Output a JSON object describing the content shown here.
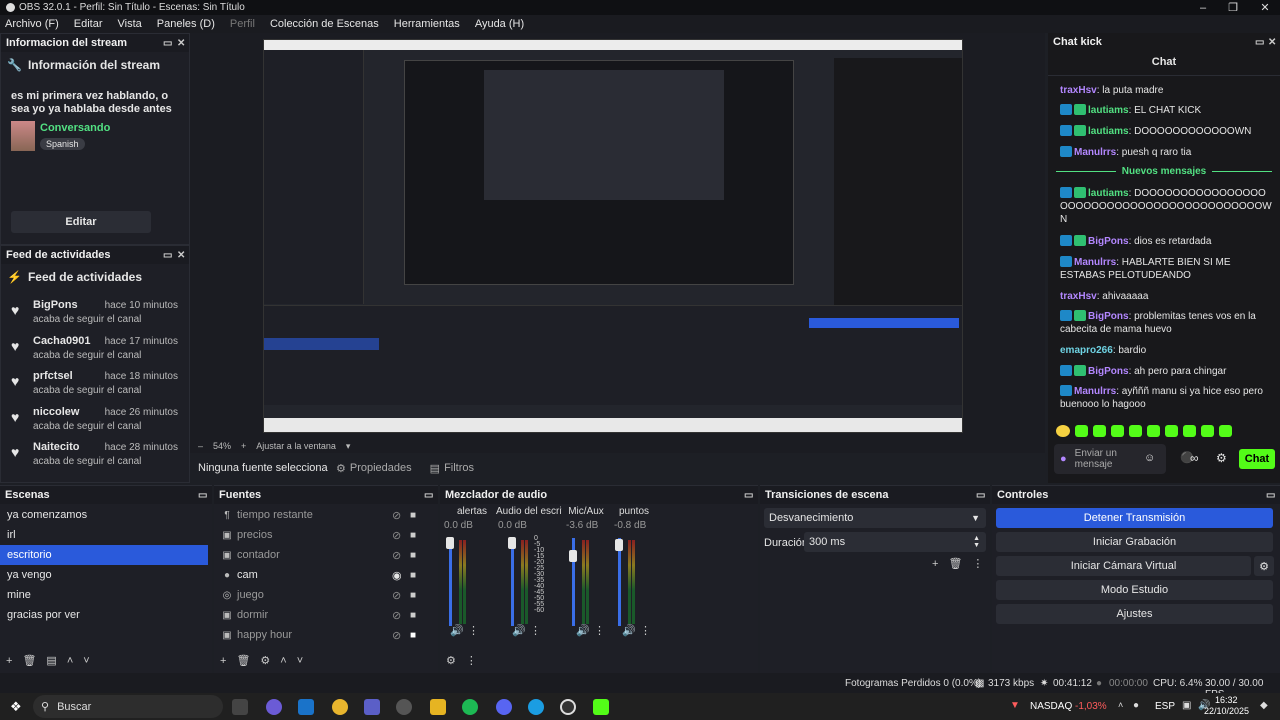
{
  "window": {
    "title": "OBS 32.0.1 - Perfil: Sin Título - Escenas: Sin Título"
  },
  "menu": [
    "Archivo (F)",
    "Editar",
    "Vista",
    "Paneles (D)",
    "Perfil",
    "Colección de Escenas",
    "Herramientas",
    "Ayuda (H)"
  ],
  "stream_info": {
    "dock_title": "Informacion del stream",
    "header": "Información del stream",
    "title": "es mi primera vez hablando, o sea yo ya hablaba desde antes",
    "category": "Conversando",
    "language": "Spanish",
    "edit_label": "Editar"
  },
  "activity": {
    "dock_title": "Feed de actividades",
    "header": "Feed de actividades",
    "items": [
      {
        "name": "BigPons",
        "time": "hace 10 minutos",
        "action": "acaba de seguir el canal"
      },
      {
        "name": "Cacha0901",
        "time": "hace 17 minutos",
        "action": "acaba de seguir el canal"
      },
      {
        "name": "prfctsel",
        "time": "hace 18 minutos",
        "action": "acaba de seguir el canal"
      },
      {
        "name": "niccolew",
        "time": "hace 26 minutos",
        "action": "acaba de seguir el canal"
      },
      {
        "name": "Naitecito",
        "time": "hace 28 minutos",
        "action": "acaba de seguir el canal"
      }
    ]
  },
  "preview_bar": {
    "zoom": "54%",
    "fit_label": "Ajustar a la ventana"
  },
  "source_bar": {
    "status": "Ninguna fuente seleccionad",
    "props_label": "Propiedades",
    "filters_label": "Filtros"
  },
  "chat": {
    "dock_title": "Chat kick",
    "header": "Chat",
    "messages": [
      {
        "user": "traxHsv",
        "text": ": la puta madre"
      },
      {
        "user": "lautiams",
        "text": ": EL CHAT KICK"
      },
      {
        "user": "lautiams",
        "text": ": DOOOOOOOOOOOOWN"
      },
      {
        "user": "Manulrrs",
        "text": ": puesh q raro tia"
      },
      {
        "user": "lautiams",
        "text": ": DOOOOOOOOOOOOOOOOOOOOOOOOOOOOOOOOOOOOOOOOOOWN"
      },
      {
        "user": "BigPons",
        "text": ": dios es retardada"
      },
      {
        "user": "Manulrrs",
        "text": ": HABLARTE BIEN SI ME ESTABAS PELOTUDEANDO"
      },
      {
        "user": "traxHsv",
        "text": ": ahivaaaaa"
      },
      {
        "user": "BigPons",
        "text": ": problemitas tenes vos en la cabecita de mama huevo"
      },
      {
        "user": "emapro266",
        "text": ": bardio"
      },
      {
        "user": "BigPons",
        "text": ": ah pero para chingar"
      },
      {
        "user": "Manulrrs",
        "text": ": ayñññ manu si ya hice eso pero buenooo lo hagooo"
      }
    ],
    "new_messages_label": "Nuevos mensajes",
    "input_placeholder": "Enviar un mensaje",
    "infinity": "∞",
    "send_label": "Chat"
  },
  "scenes": {
    "dock_title": "Escenas",
    "items": [
      "ya comenzamos",
      "irl",
      "escritorio",
      "ya vengo",
      "mine",
      "gracias por ver"
    ],
    "selected": "escritorio"
  },
  "sources": {
    "dock_title": "Fuentes",
    "items": [
      {
        "name": "tiempo restante",
        "icon": "text-icon"
      },
      {
        "name": "precios",
        "icon": "image-icon"
      },
      {
        "name": "contador",
        "icon": "image-icon"
      },
      {
        "name": "cam",
        "icon": "camera-icon"
      },
      {
        "name": "juego",
        "icon": "gamepad-icon"
      },
      {
        "name": "dormir",
        "icon": "image-icon"
      },
      {
        "name": "happy hour",
        "icon": "image-icon"
      }
    ]
  },
  "mixer": {
    "dock_title": "Mezclador de audio",
    "channels": [
      {
        "name": "alertas",
        "db": "0.0 dB"
      },
      {
        "name": "Audio del escritorio",
        "db": "0.0 dB"
      },
      {
        "name": "Mic/Aux",
        "db": "-3.6 dB"
      },
      {
        "name": "puntos",
        "db": "-0.8 dB"
      }
    ],
    "scale": [
      "0",
      "-5",
      "-10",
      "-15",
      "-20",
      "-25",
      "-30",
      "-35",
      "-40",
      "-45",
      "-50",
      "-55",
      "-60"
    ]
  },
  "transitions": {
    "dock_title": "Transiciones de escena",
    "selected": "Desvanecimiento",
    "duration_label": "Duración",
    "duration_value": "300 ms"
  },
  "controls": {
    "dock_title": "Controles",
    "stop_stream": "Detener Transmisión",
    "start_record": "Iniciar Grabación",
    "virtual_cam": "Iniciar Cámara Virtual",
    "studio_mode": "Modo Estudio",
    "settings": "Ajustes"
  },
  "status": {
    "dropped": "Fotogramas Perdidos 0 (0.0%)",
    "bitrate": "3173 kbps",
    "stream_time": "00:41:12",
    "rec_time": "00:00:00",
    "cpu": "CPU: 6.4%",
    "fps": "30.00 / 30.00 FPS"
  },
  "taskbar": {
    "search": "Buscar",
    "stock_name": "NASDAQ",
    "stock_change": "-1,03%",
    "lang": "ESP",
    "time": "16:32",
    "date": "22/10/2025"
  },
  "colors": {
    "accent": "#2a5adb",
    "kick_green": "#53fc18",
    "negative": "#ff5c5c"
  }
}
